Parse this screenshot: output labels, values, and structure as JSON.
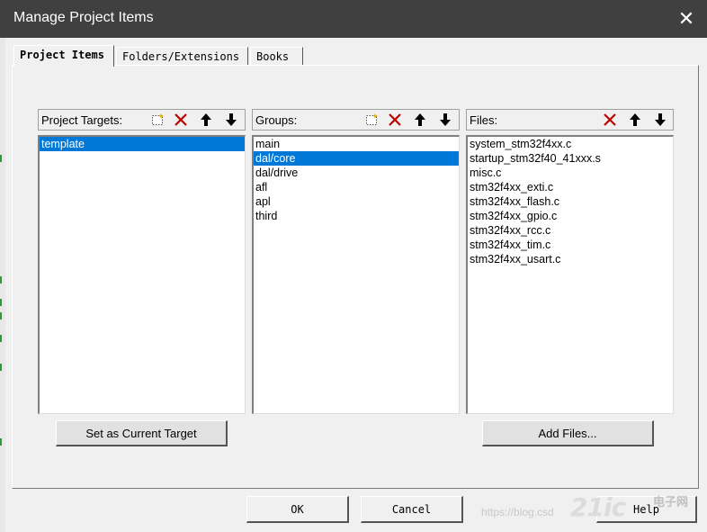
{
  "window": {
    "title": "Manage Project Items",
    "close_glyph": "✕"
  },
  "tabs": [
    {
      "label": "Project Items",
      "active": true
    },
    {
      "label": "Folders/Extensions",
      "active": false
    },
    {
      "label": "Books",
      "active": false
    }
  ],
  "targets": {
    "header": "Project Targets:",
    "items": [
      "template"
    ],
    "selected": "template"
  },
  "groups": {
    "header": "Groups:",
    "items": [
      "main",
      "dal/core",
      "dal/drive",
      "afl",
      "apl",
      "third"
    ],
    "selected": "dal/core"
  },
  "files": {
    "header": "Files:",
    "items": [
      "system_stm32f4xx.c",
      "startup_stm32f40_41xxx.s",
      "misc.c",
      "stm32f4xx_exti.c",
      "stm32f4xx_flash.c",
      "stm32f4xx_gpio.c",
      "stm32f4xx_rcc.c",
      "stm32f4xx_tim.c",
      "stm32f4xx_usart.c"
    ]
  },
  "buttons": {
    "set_target": "Set as Current Target",
    "add_files": "Add Files...",
    "ok": "OK",
    "cancel": "Cancel",
    "help": "Help"
  },
  "toolbar_icons": [
    "new-icon",
    "delete-icon",
    "move-up-icon",
    "move-down-icon"
  ],
  "watermark": {
    "url": "https://blog.csd",
    "brand": "21ic",
    "brand2": "电子网"
  },
  "colors": {
    "titlebar": "#404040",
    "selection": "#0078d7",
    "delete": "#c00000",
    "face": "#f0f0f0"
  }
}
